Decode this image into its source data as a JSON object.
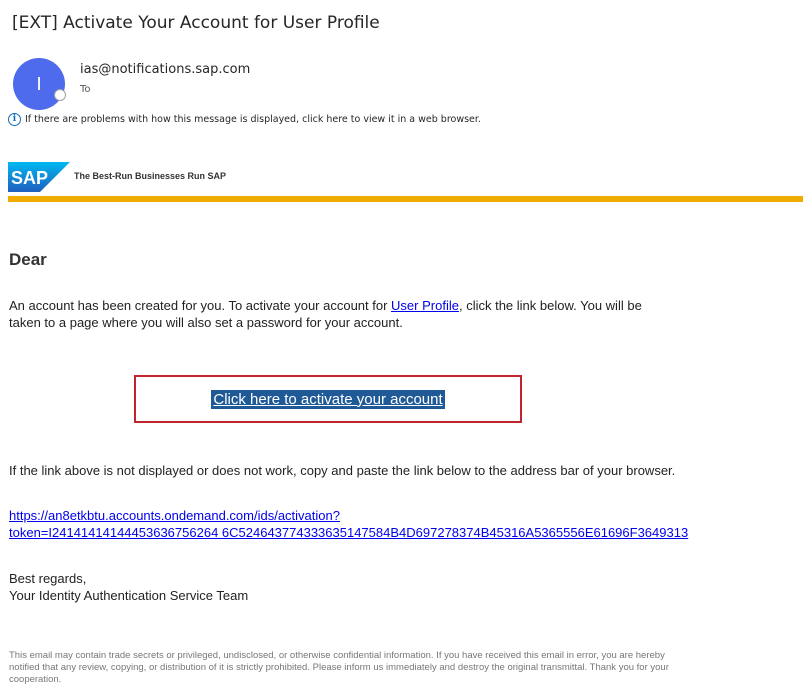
{
  "email": {
    "subject": "[EXT] Activate Your Account for User Profile",
    "sender": "ias@notifications.sap.com",
    "sender_initial": "I",
    "to_label": "To",
    "info_bar_text": "If there are problems with how this message is displayed, click here to view it in a web browser."
  },
  "brand": {
    "logo_text": "SAP",
    "tagline": "The Best-Run Businesses Run SAP",
    "logo_color": "#008fd3",
    "bar_color": "#f0ab00"
  },
  "body": {
    "greeting": "Dear",
    "para_part1": "An account has been created for you. To activate your account for ",
    "para_link": "User Profile",
    "para_part2": ", click the link below. You will be taken to a page where you will also set a password for your account.",
    "cta_label": "Click here to activate your account",
    "fallback_text": "If the link above is not displayed or does not work, copy and paste the link below to the address bar of your browser.",
    "activation_link_line1": "https://an8etkbtu.accounts.ondemand.com/ids/activation?",
    "activation_link_line2": "token=I24141414144453636756264 6C524643774333635147584B4D697278374B45316A5365556E61696F3649313",
    "signoff_line1": "Best regards,",
    "signoff_line2": "Your Identity Authentication Service Team",
    "disclaimer": "This email may contain trade secrets or privileged, undisclosed, or otherwise confidential information. If you have received this email in error, you are hereby notified that any review, copying, or distribution of it is strictly prohibited. Please inform us immediately and destroy the original transmittal. Thank you for your cooperation."
  },
  "colors": {
    "avatar": "#4f6bed",
    "cta_border": "#c0252c",
    "cta_highlight": "#1f5a96",
    "link": "#0000ee"
  }
}
